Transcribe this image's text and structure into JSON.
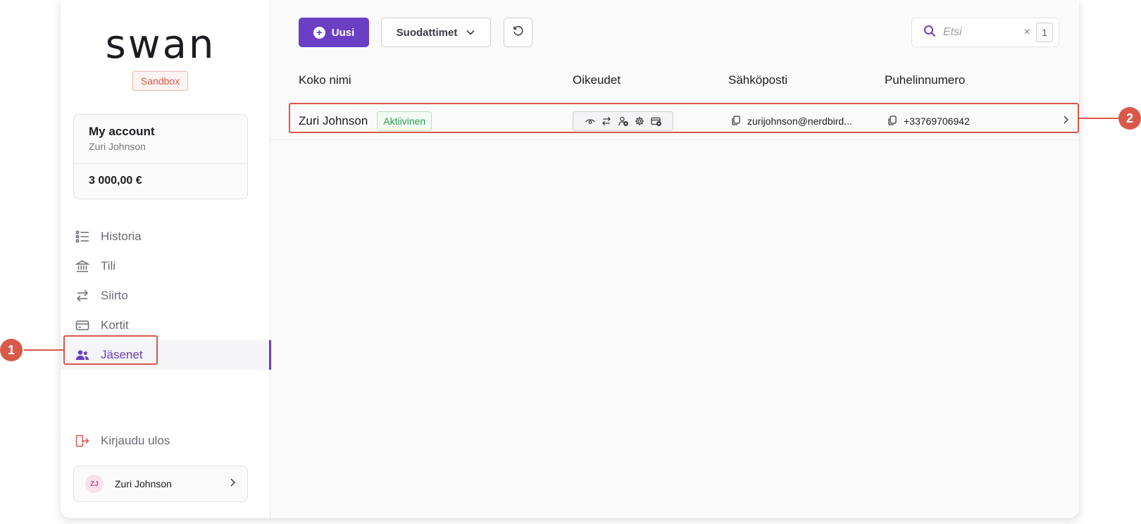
{
  "sidebar": {
    "logo": "swan",
    "environment_badge": "Sandbox",
    "account": {
      "title": "My account",
      "holder": "Zuri Johnson",
      "balance": "3 000,00 €"
    },
    "nav": [
      {
        "label": "Historia",
        "icon": "list-icon"
      },
      {
        "label": "Tili",
        "icon": "bank-icon"
      },
      {
        "label": "Siirto",
        "icon": "transfer-icon"
      },
      {
        "label": "Kortit",
        "icon": "card-icon"
      },
      {
        "label": "Jäsenet",
        "icon": "members-icon",
        "active": true
      }
    ],
    "logout_label": "Kirjaudu ulos",
    "user": {
      "initials": "ZJ",
      "name": "Zuri Johnson"
    }
  },
  "toolbar": {
    "new_label": "Uusi",
    "filter_label": "Suodattimet",
    "search_placeholder": "Etsi",
    "filter_count": "1"
  },
  "table": {
    "columns": [
      "Koko nimi",
      "Oikeudet",
      "Sähköposti",
      "Puhelinnumero"
    ],
    "rows": [
      {
        "name": "Zuri Johnson",
        "status": "Aktiivinen",
        "permissions": [
          "view-icon",
          "transfer-icon",
          "user-add-icon",
          "settings-icon",
          "card-add-icon"
        ],
        "email": "zurijohnson@nerdbird...",
        "phone": "+33769706942"
      }
    ]
  },
  "annotations": [
    "1",
    "2"
  ],
  "colors": {
    "accent": "#6b3fc4",
    "annotation": "#d9584a",
    "active_status": "#2e9a52",
    "sandbox": "#d65a45"
  }
}
